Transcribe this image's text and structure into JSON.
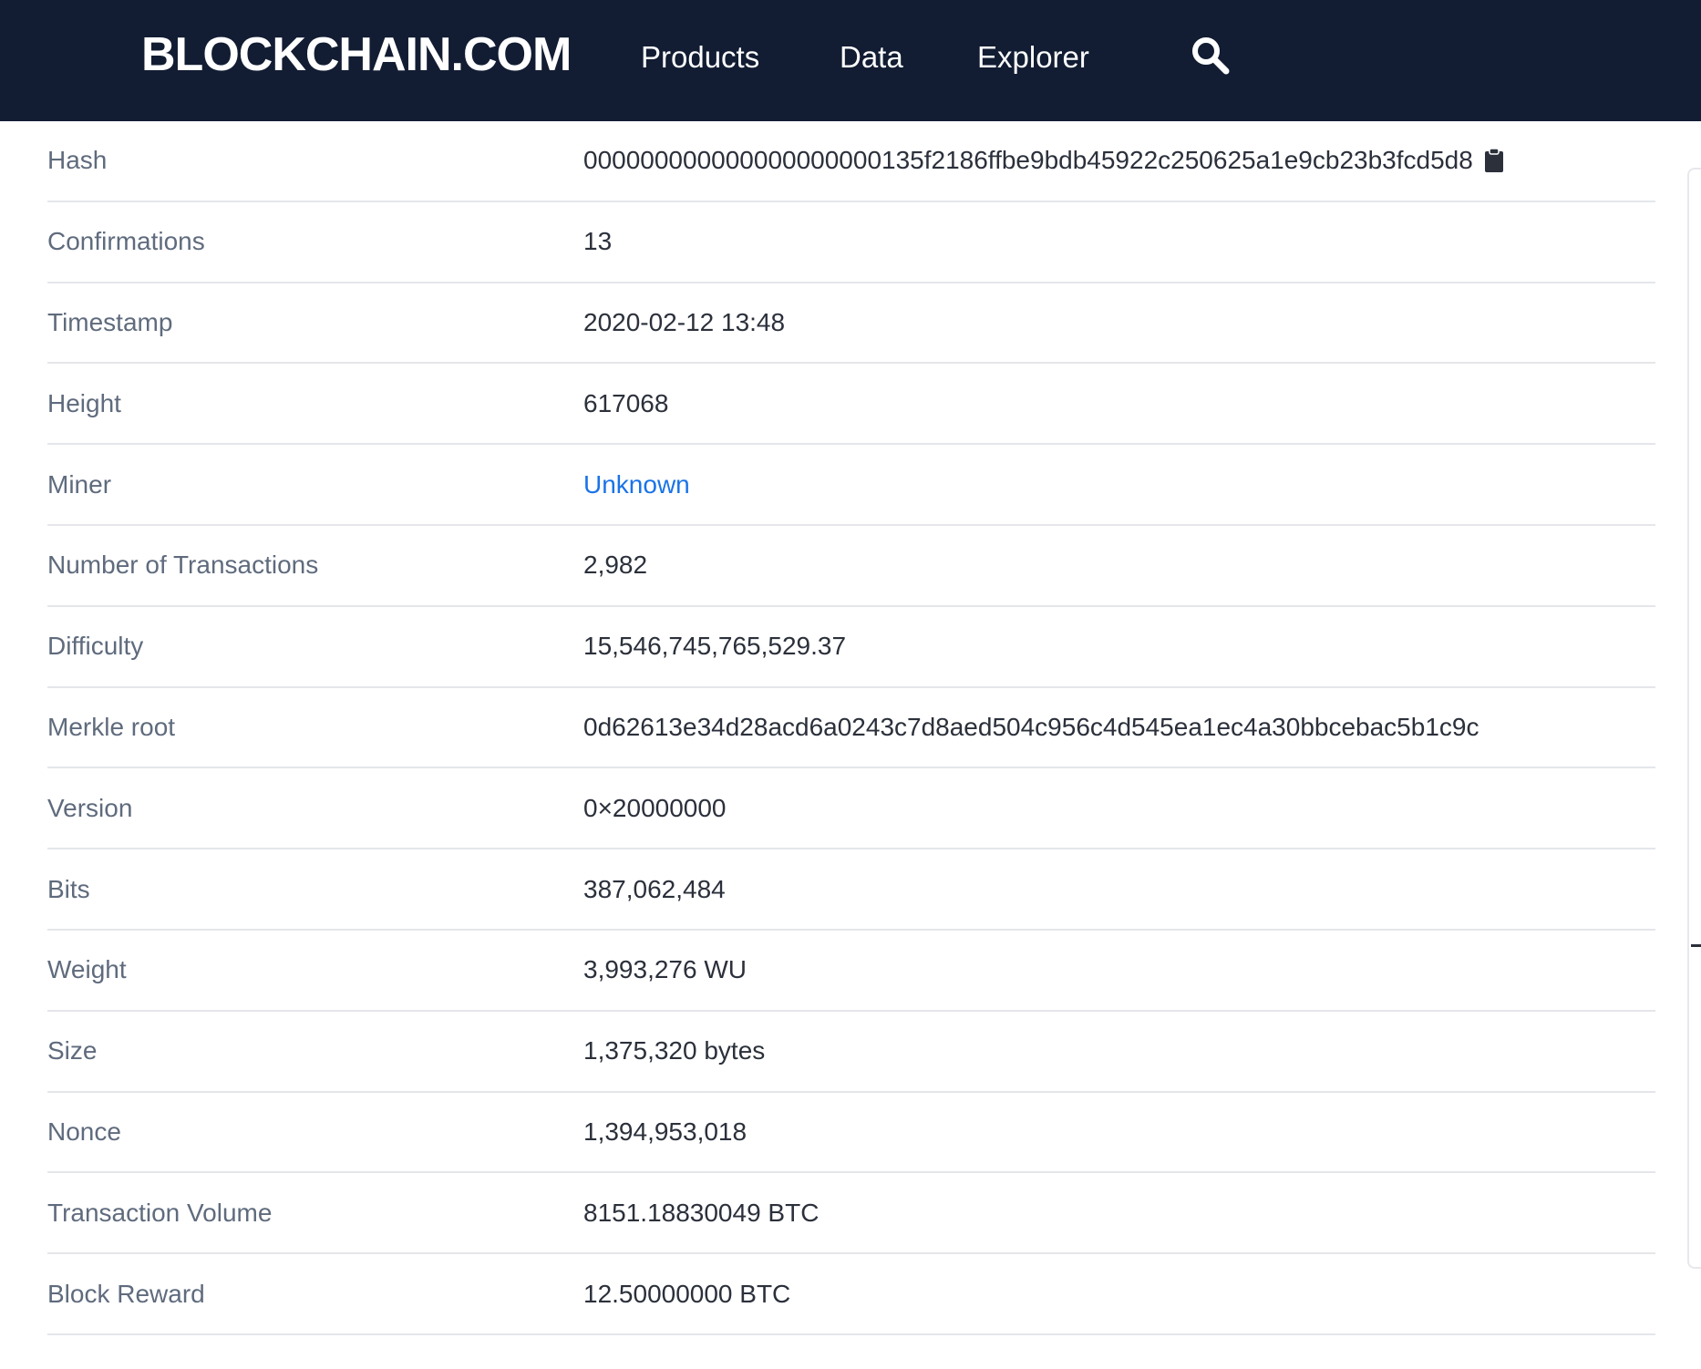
{
  "header": {
    "logo": "BLOCKCHAIN.COM",
    "nav": [
      "Products",
      "Data",
      "Explorer"
    ],
    "search_icon": "search-icon"
  },
  "colors": {
    "header_bg": "#121d33",
    "link": "#1a73e8",
    "label": "#5f6b7d",
    "value": "#2b303b"
  },
  "rows": [
    {
      "label": "Hash",
      "value": "000000000000000000000135f2186ffbe9bdb45922c250625a1e9cb23b3fcd5d8"
    },
    {
      "label": "Confirmations",
      "value": "13"
    },
    {
      "label": "Timestamp",
      "value": "2020-02-12 13:48"
    },
    {
      "label": "Height",
      "value": "617068"
    },
    {
      "label": "Miner",
      "value": "Unknown"
    },
    {
      "label": "Number of Transactions",
      "value": "2,982"
    },
    {
      "label": "Difficulty",
      "value": "15,546,745,765,529.37"
    },
    {
      "label": "Merkle root",
      "value": "0d62613e34d28acd6a0243c7d8aed504c956c4d545ea1ec4a30bbcebac5b1c9c"
    },
    {
      "label": "Version",
      "value": "0×20000000"
    },
    {
      "label": "Bits",
      "value": "387,062,484"
    },
    {
      "label": "Weight",
      "value": "3,993,276 WU"
    },
    {
      "label": "Size",
      "value": "1,375,320 bytes"
    },
    {
      "label": "Nonce",
      "value": "1,394,953,018"
    },
    {
      "label": "Transaction Volume",
      "value": "8151.18830049 BTC"
    },
    {
      "label": "Block Reward",
      "value": "12.50000000 BTC"
    }
  ]
}
